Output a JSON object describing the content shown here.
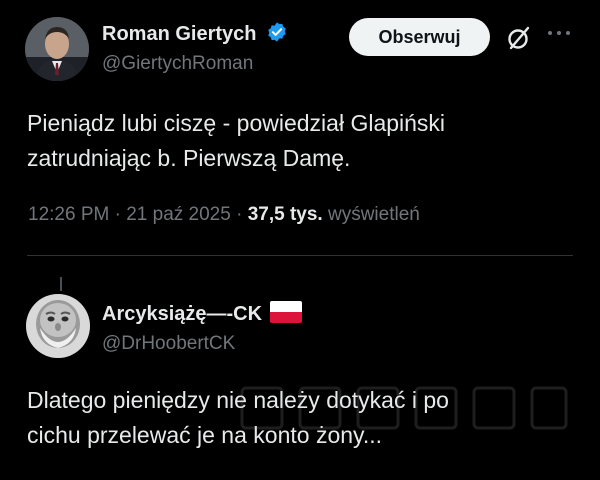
{
  "tweet": {
    "author_name": "Roman Giertych",
    "author_handle": "@GiertychRoman",
    "follow_label": "Obserwuj",
    "text_line1": "Pieniądz lubi ciszę - powiedział Glapiński",
    "text_line2": "zatrudniając b. Pierwszą Damę.",
    "time": "12:26 PM",
    "date": "21 paź 2025",
    "views_count": "37,5 tys.",
    "views_label": "wyświetleń",
    "separator": "·"
  },
  "reply": {
    "author_name": "Arcyksiążę—-CK",
    "author_handle": "@DrHoobertCK",
    "text_line1": "Dlatego pieniędzy nie należy dotykać i po",
    "text_line2": "cichu przelewać je na konto żony..."
  },
  "colors": {
    "background": "#000000",
    "text_primary": "#e7e9ea",
    "text_secondary": "#71767b",
    "verified_blue": "#1d9bf0",
    "button_bg": "#eff3f4"
  },
  "icons": {
    "verified": "verified-badge-icon",
    "grok": "grok-icon",
    "more": "more-options-icon",
    "flag": "poland-flag-icon"
  }
}
